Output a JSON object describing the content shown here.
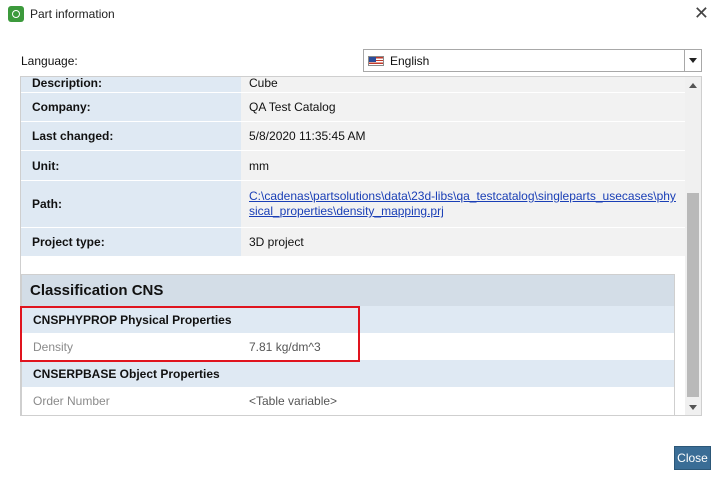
{
  "window": {
    "title": "Part information",
    "close_glyph": "✕"
  },
  "language": {
    "label": "Language:",
    "selected": "English"
  },
  "properties": [
    {
      "key": "Description:",
      "value": "Cube"
    },
    {
      "key": "Company:",
      "value": "QA Test Catalog"
    },
    {
      "key": "Last changed:",
      "value": "5/8/2020 11:35:45 AM"
    },
    {
      "key": "Unit:",
      "value": "mm"
    },
    {
      "key": "Path:",
      "value": "C:\\cadenas\\partsolutions\\data\\23d-libs\\qa_testcatalog\\singleparts_usecases\\physical_properties\\density_mapping.prj"
    },
    {
      "key": "Project type:",
      "value": "3D project"
    }
  ],
  "classification": {
    "title": "Classification CNS",
    "categories": [
      {
        "name": "CNSPHYPROP Physical Properties",
        "items": [
          {
            "key": "Density",
            "value": "7.81 kg/dm^3"
          }
        ]
      },
      {
        "name": "CNSERPBASE Object Properties",
        "items": [
          {
            "key": "Order Number",
            "value": "<Table variable>"
          }
        ]
      }
    ]
  },
  "footer": {
    "close_label": "Close"
  },
  "colors": {
    "accent": "#3a6d96",
    "highlight": "#e0141e",
    "link": "#1a3fb6"
  }
}
